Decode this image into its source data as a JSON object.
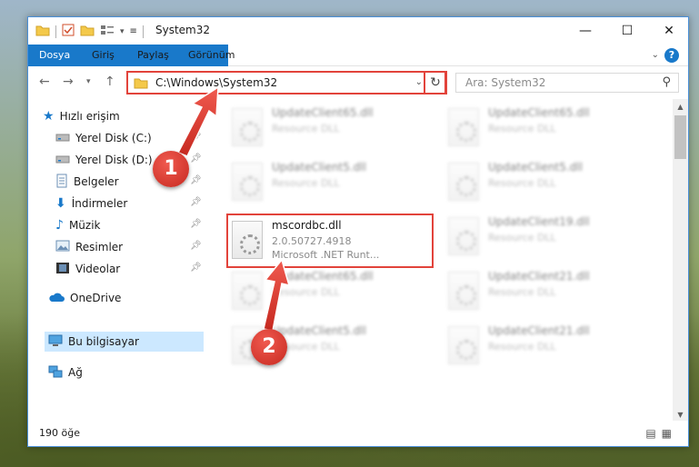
{
  "window": {
    "title": "System32",
    "controls": {
      "minimize": "—",
      "maximize": "☐",
      "close": "✕"
    }
  },
  "ribbon": {
    "tabs": [
      "Dosya",
      "Giriş",
      "Paylaş",
      "Görünüm"
    ]
  },
  "address": {
    "path": "C:\\Windows\\System32",
    "search_placeholder": "Ara: System32"
  },
  "nav": {
    "items": [
      {
        "label": "Hızlı erişim",
        "icon": "star-icon"
      },
      {
        "label": "Yerel Disk (C:)",
        "icon": "drive-icon",
        "pinned": true
      },
      {
        "label": "Yerel Disk (D:)",
        "icon": "drive-icon",
        "pinned": true
      },
      {
        "label": "Belgeler",
        "icon": "documents-icon",
        "pinned": true
      },
      {
        "label": "İndirmeler",
        "icon": "download-icon",
        "pinned": true
      },
      {
        "label": "Müzik",
        "icon": "music-icon",
        "pinned": true
      },
      {
        "label": "Resimler",
        "icon": "pictures-icon",
        "pinned": true
      },
      {
        "label": "Videolar",
        "icon": "video-icon",
        "pinned": true
      },
      {
        "label": "OneDrive",
        "icon": "cloud-icon"
      },
      {
        "label": "Bu bilgisayar",
        "icon": "computer-icon",
        "selected": true
      },
      {
        "label": "Ağ",
        "icon": "network-icon"
      }
    ]
  },
  "files": {
    "left": [
      {
        "name": "UpdateClient65.dll",
        "d1": "Resource DLL",
        "d2": ""
      },
      {
        "name": "UpdateClient5.dll",
        "d1": "Resource DLL",
        "d2": ""
      },
      {
        "name": "mscordbc.dll",
        "d1": "2.0.50727.4918",
        "d2": "Microsoft .NET Runt..."
      },
      {
        "name": "UpdateClient65.dll",
        "d1": "Resource DLL",
        "d2": ""
      },
      {
        "name": "UpdateClient5.dll",
        "d1": "Resource DLL",
        "d2": ""
      }
    ],
    "right": [
      {
        "name": "UpdateClient65.dll",
        "d1": "Resource DLL"
      },
      {
        "name": "UpdateClient5.dll",
        "d1": "Resource DLL"
      },
      {
        "name": "UpdateClient19.dll",
        "d1": "Resource DLL"
      },
      {
        "name": "UpdateClient21.dll",
        "d1": "Resource DLL"
      },
      {
        "name": "UpdateClient21.dll",
        "d1": "Resource DLL"
      }
    ]
  },
  "status": {
    "count": "190 öğe"
  },
  "annotations": {
    "one": "1",
    "two": "2"
  },
  "colors": {
    "accent": "#1979ca",
    "highlight": "#e2433b",
    "selected": "#cce8ff"
  }
}
